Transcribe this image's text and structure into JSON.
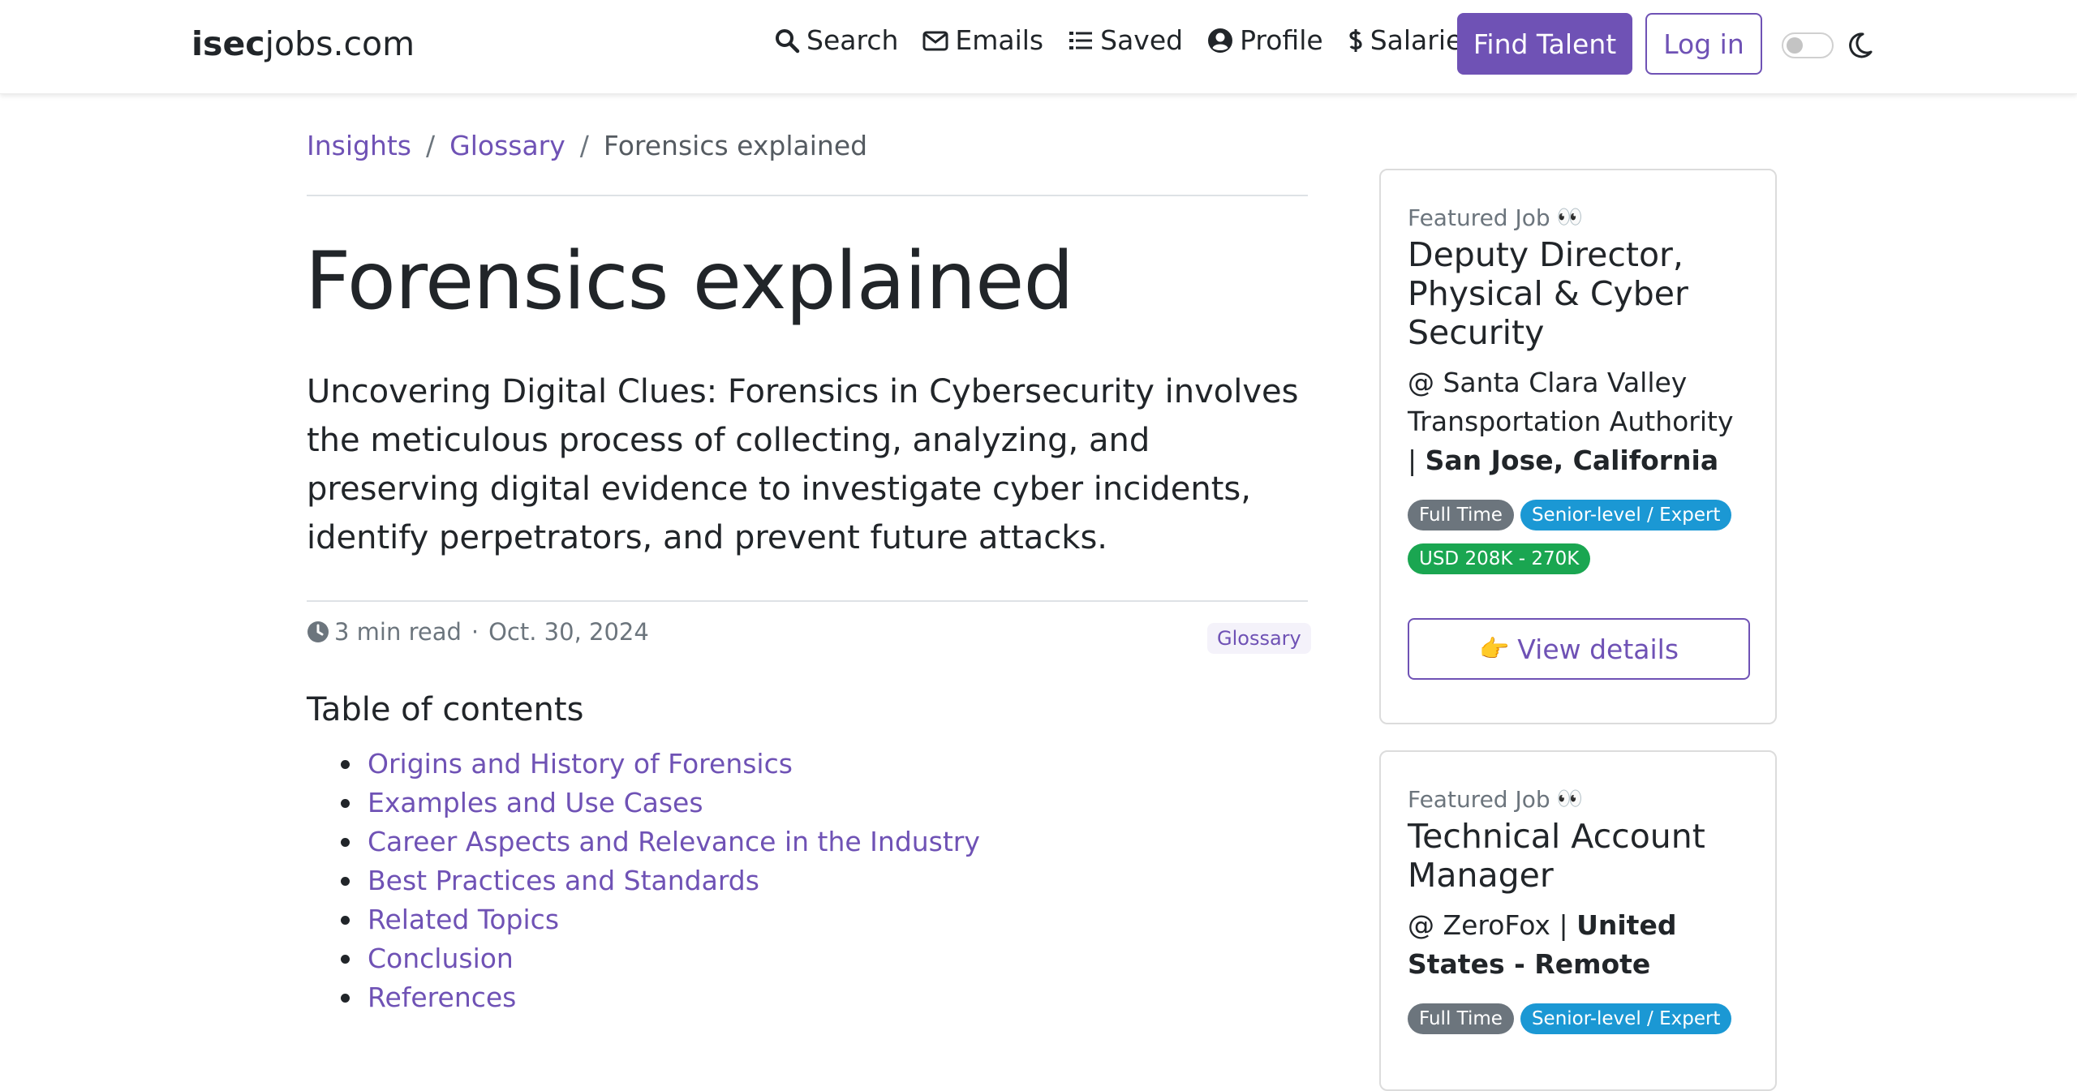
{
  "brand": {
    "bold": "isec",
    "rest": "jobs.com"
  },
  "nav": {
    "links": [
      {
        "label": "Search",
        "icon": "search-icon"
      },
      {
        "label": "Emails",
        "icon": "envelope-icon"
      },
      {
        "label": "Saved",
        "icon": "list-icon"
      },
      {
        "label": "Profile",
        "icon": "user-circle-icon"
      },
      {
        "label": "Salaries",
        "icon": "dollar-icon"
      }
    ],
    "find_talent": "Find Talent",
    "login": "Log in"
  },
  "breadcrumb": {
    "items": [
      "Insights",
      "Glossary"
    ],
    "current": "Forensics explained",
    "sep": "/"
  },
  "article": {
    "title": "Forensics explained",
    "lead": "Uncovering Digital Clues: Forensics in Cybersecurity involves the meticulous process of collecting, analyzing, and preserving digital evidence to investigate cyber incidents, identify perpetrators, and prevent future attacks.",
    "read_time": "3 min read",
    "date": "Oct. 30, 2024",
    "category": "Glossary",
    "toc_heading": "Table of contents",
    "toc": [
      "Origins and History of Forensics",
      "Examples and Use Cases",
      "Career Aspects and Relevance in the Industry",
      "Best Practices and Standards",
      "Related Topics",
      "Conclusion",
      "References"
    ]
  },
  "featured_jobs": [
    {
      "label": "Featured Job",
      "emoji": "👀",
      "title": "Deputy Director, Physical & Cyber Security",
      "company": "@ Santa Clara Valley Transportation Authority",
      "location": "San Jose, California",
      "badges": [
        "Full Time",
        "Senior-level / Expert",
        "USD 208K - 270K"
      ],
      "button": "View details",
      "button_emoji": "👉"
    },
    {
      "label": "Featured Job",
      "emoji": "👀",
      "title": "Technical Account Manager",
      "company": "@ ZeroFox",
      "location": "United States - Remote",
      "badges": [
        "Full Time",
        "Senior-level / Expert"
      ]
    }
  ],
  "colors": {
    "accent": "#6f52b5",
    "badge_full_time": "#6c757d",
    "badge_level": "#1b98d4",
    "badge_salary": "#1aa651"
  }
}
